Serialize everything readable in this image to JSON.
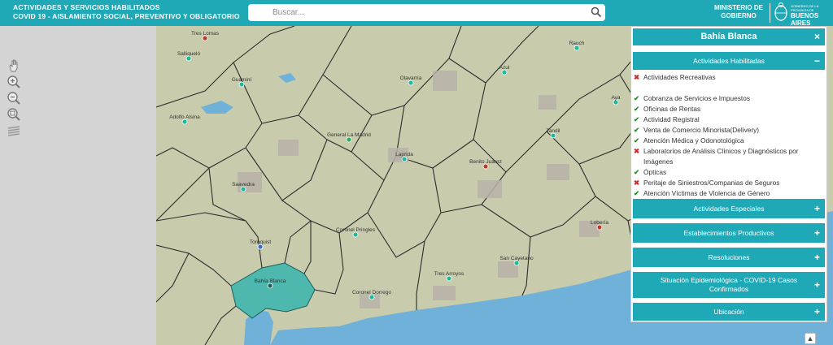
{
  "header": {
    "title_line1": "ACTIVIDADES Y SERVICIOS HABILITADOS",
    "title_line2": "COVID 19 - AISLAMIENTO SOCIAL, PREVENTIVO Y OBLIGATORIO",
    "search_placeholder": "Buscar...",
    "ministry_line1": "MINISTERIO DE",
    "ministry_line2": "GOBIERNO",
    "gov_small": "GOBIERNO DE LA PROVINCIA DE",
    "gov_big": "BUENOS AIRES"
  },
  "map": {
    "places": [
      {
        "name": "Tres Lomas"
      },
      {
        "name": "Salliqueló"
      },
      {
        "name": "Guaminí"
      },
      {
        "name": "Adolfo Alsina"
      },
      {
        "name": "Olavarría"
      },
      {
        "name": "Azul"
      },
      {
        "name": "Rauch"
      },
      {
        "name": "Aya"
      },
      {
        "name": "General La Madrid"
      },
      {
        "name": "Laprida"
      },
      {
        "name": "Tandil"
      },
      {
        "name": "Benito Juárez"
      },
      {
        "name": "Saavedra"
      },
      {
        "name": "Tornquist"
      },
      {
        "name": "Coronel Pringles"
      },
      {
        "name": "Bahía Blanca"
      },
      {
        "name": "Coronel Dorrego"
      },
      {
        "name": "Tres Arroyos"
      },
      {
        "name": "San Cayetano"
      },
      {
        "name": "Lobería"
      }
    ],
    "colors": {
      "land": "#c8ccad",
      "water": "#6fb1d9",
      "highlight": "#4fb8ae",
      "grey": "#d4d4d4"
    }
  },
  "tools": [
    "hand-icon",
    "zoom-in-icon",
    "zoom-out-icon",
    "zoom-box-icon",
    "layers-icon"
  ],
  "panel": {
    "title": "Bahía Blanca",
    "close_label": "×",
    "sections": [
      {
        "label": "Actividades Habilitadas",
        "sign": "−"
      },
      {
        "label": "Actividades Especiales",
        "sign": "+"
      },
      {
        "label": "Establecimientos Productivos",
        "sign": "+"
      },
      {
        "label": "Resoluciones",
        "sign": "+"
      },
      {
        "label": "Situación Epidemiológica - COVID-19 Casos Confirmados",
        "sign": "+"
      },
      {
        "label": "Ubicación",
        "sign": "+"
      }
    ],
    "items": [
      {
        "text": "Actividades Recreativas",
        "status": "no"
      },
      {
        "text": "Cobranza de Servicios e Impuestos",
        "status": "ok"
      },
      {
        "text": "Oficinas de Rentas",
        "status": "ok"
      },
      {
        "text": "Actividad Registral",
        "status": "ok"
      },
      {
        "text": "Venta de Comercio Minorista(Delivery)",
        "status": "ok"
      },
      {
        "text": "Atención Médica y Odonotológica",
        "status": "ok"
      },
      {
        "text": "Laboratorios de Análisis Clínicos y Diagnósticos por Imágenes",
        "status": "no"
      },
      {
        "text": "Ópticas",
        "status": "ok"
      },
      {
        "text": "Peritaje de Siniestros/Companias de Seguros",
        "status": "no"
      },
      {
        "text": "Atención Víctimas de Violencia de Género",
        "status": "ok"
      }
    ],
    "marks": {
      "ok": "✔",
      "no": "✖"
    }
  }
}
